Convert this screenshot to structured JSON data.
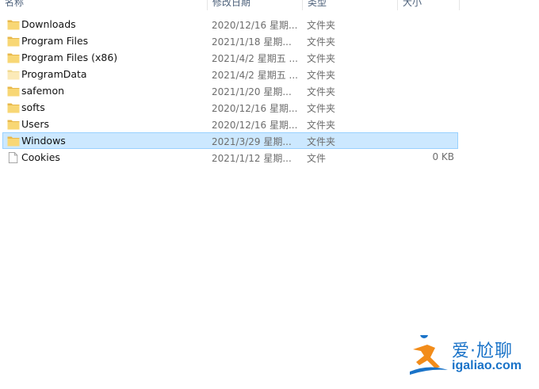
{
  "columns": {
    "name": "名称",
    "date": "修改日期",
    "type": "类型",
    "size": "大小"
  },
  "files": [
    {
      "name": "Downloads",
      "date": "2020/12/16 星期...",
      "type": "文件夹",
      "size": "",
      "icon": "folder-icon"
    },
    {
      "name": "Program Files",
      "date": "2021/1/18 星期...",
      "type": "文件夹",
      "size": "",
      "icon": "folder-icon"
    },
    {
      "name": "Program Files (x86)",
      "date": "2021/4/2 星期五 ...",
      "type": "文件夹",
      "size": "",
      "icon": "folder-icon"
    },
    {
      "name": "ProgramData",
      "date": "2021/4/2 星期五 ...",
      "type": "文件夹",
      "size": "",
      "icon": "hidden-folder-icon"
    },
    {
      "name": "safemon",
      "date": "2021/1/20 星期...",
      "type": "文件夹",
      "size": "",
      "icon": "folder-icon"
    },
    {
      "name": "softs",
      "date": "2020/12/16 星期...",
      "type": "文件夹",
      "size": "",
      "icon": "folder-icon"
    },
    {
      "name": "Users",
      "date": "2020/12/16 星期...",
      "type": "文件夹",
      "size": "",
      "icon": "folder-icon"
    },
    {
      "name": "Windows",
      "date": "2021/3/29 星期...",
      "type": "文件夹",
      "size": "",
      "icon": "folder-icon",
      "selected": true
    },
    {
      "name": "Cookies",
      "date": "2021/1/12 星期...",
      "type": "文件",
      "size": "0 KB",
      "icon": "file-icon"
    }
  ],
  "watermark": {
    "title": "爱·尬聊",
    "url": "igaliao.com"
  },
  "colors": {
    "folder": "#f8d775",
    "folder_dark": "#e8b84a",
    "hidden_folder": "#fbeab8",
    "selection_bg": "#cce8ff",
    "selection_border": "#99d1ff",
    "watermark_blue": "#1a73c8",
    "watermark_orange": "#f28c1a"
  }
}
